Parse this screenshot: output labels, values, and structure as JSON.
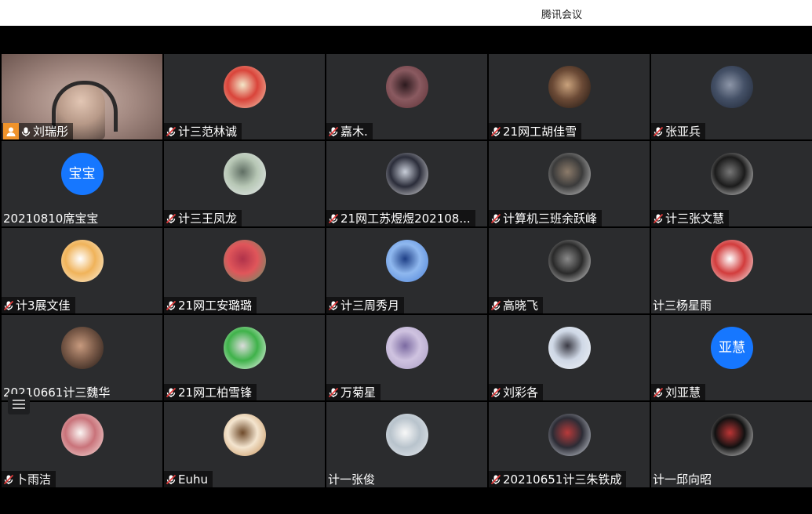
{
  "window": {
    "title": "腾讯会议"
  },
  "participants": [
    {
      "name": "刘瑞彤",
      "mic": "on",
      "video": true,
      "host": true
    },
    {
      "name": "计三范林诚",
      "mic": "muted",
      "avatar_colors": [
        "#f6d2b8",
        "#d9443a",
        "#f3e7c9"
      ]
    },
    {
      "name": "嘉木.",
      "mic": "muted",
      "avatar_colors": [
        "#5a2e33",
        "#8a5a60",
        "#2c1a1e"
      ]
    },
    {
      "name": "21网工胡佳雪",
      "mic": "muted",
      "avatar_colors": [
        "#1b1410",
        "#6b4a36",
        "#c9a27c"
      ]
    },
    {
      "name": "张亚兵",
      "mic": "muted",
      "avatar_colors": [
        "#1c2433",
        "#445066",
        "#8d96a8"
      ]
    },
    {
      "name": "20210810席宝宝",
      "mic": "none",
      "avatar_text": "宝宝",
      "avatar_colors": [
        "#1677ff"
      ]
    },
    {
      "name": "计三王凤龙",
      "mic": "muted",
      "avatar_colors": [
        "#e8ecef",
        "#b7c7b5",
        "#5f6e63"
      ]
    },
    {
      "name": "21网工苏煜煜202108...",
      "mic": "muted",
      "avatar_colors": [
        "#f1f1f1",
        "#2b2d3a",
        "#c9ced9"
      ]
    },
    {
      "name": "计算机三班余跃峰",
      "mic": "muted",
      "avatar_colors": [
        "#d9d9d9",
        "#3b3b3b",
        "#8c7b6a"
      ]
    },
    {
      "name": "计三张文慧",
      "mic": "muted",
      "avatar_colors": [
        "#f3f3f3",
        "#1b1b1b",
        "#777777"
      ]
    },
    {
      "name": "计3展文佳",
      "mic": "muted",
      "avatar_colors": [
        "#fbf3e2",
        "#f0b35a",
        "#ffffff"
      ]
    },
    {
      "name": "21网工安璐璐",
      "mic": "muted",
      "avatar_colors": [
        "#5a9b6a",
        "#e0565a",
        "#b0324a"
      ]
    },
    {
      "name": "计三周秀月",
      "mic": "muted",
      "avatar_colors": [
        "#4a7fd6",
        "#8fb8ef",
        "#1e3f86"
      ]
    },
    {
      "name": "高晓飞",
      "mic": "muted",
      "avatar_colors": [
        "#e5e5e5",
        "#2a2a2a",
        "#8a8a8a"
      ]
    },
    {
      "name": "计三杨星雨",
      "mic": "none",
      "avatar_colors": [
        "#f6f6f6",
        "#d23c3c",
        "#ffffff"
      ]
    },
    {
      "name": "20210661计三魏华",
      "mic": "none",
      "avatar_colors": [
        "#1e1714",
        "#7a5a48",
        "#c79a7e"
      ]
    },
    {
      "name": "21网工柏雪锋",
      "mic": "muted",
      "avatar_colors": [
        "#ffffff",
        "#3fb24a",
        "#dcdcdc"
      ]
    },
    {
      "name": "万菊星",
      "mic": "muted",
      "avatar_colors": [
        "#a89bc2",
        "#cfc3e0",
        "#7b6aa1"
      ]
    },
    {
      "name": "刘彩各",
      "mic": "muted",
      "avatar_colors": [
        "#f1f4f8",
        "#cfd8e6",
        "#3a3a44"
      ]
    },
    {
      "name": "刘亚慧",
      "mic": "muted",
      "avatar_text": "亚慧",
      "avatar_colors": [
        "#1677ff"
      ]
    },
    {
      "name": "卜雨洁",
      "mic": "muted",
      "avatar_colors": [
        "#f7e5e1",
        "#c9737a",
        "#fbf6f4"
      ]
    },
    {
      "name": "Euhu",
      "mic": "muted",
      "avatar_colors": [
        "#c18b50",
        "#f4e5cf",
        "#6e4a2a"
      ]
    },
    {
      "name": "计一张俊",
      "mic": "none",
      "avatar_colors": [
        "#e7ebef",
        "#b8c3cc",
        "#f8f8f8"
      ]
    },
    {
      "name": "20210651计三朱铁成",
      "mic": "muted",
      "avatar_colors": [
        "#dfe6ee",
        "#2c2c35",
        "#b83a3a"
      ]
    },
    {
      "name": "计一邱向昭",
      "mic": "none",
      "avatar_colors": [
        "#f1f1f1",
        "#111111",
        "#bb3535"
      ]
    }
  ]
}
